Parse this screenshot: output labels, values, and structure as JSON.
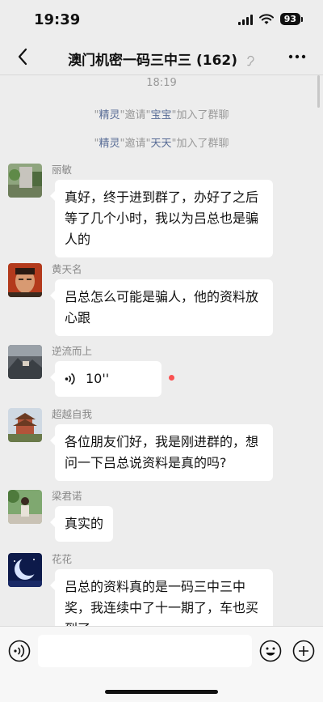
{
  "status_bar": {
    "time": "19:39",
    "battery": "93"
  },
  "header": {
    "title": "澳门机密一码三中三 (162)",
    "back_icon": "chevron-left-icon",
    "more_icon": "more-dots-icon",
    "mute_icon": "ear-mute-icon"
  },
  "chat": {
    "timestamp": "18:19",
    "system_messages": [
      {
        "pre": "\"",
        "inviter": "精灵",
        "mid": "\"邀请\"",
        "invitee": "宝宝",
        "post": "\"加入了群聊"
      },
      {
        "pre": "\"",
        "inviter": "精灵",
        "mid": "\"邀请\"",
        "invitee": "天天",
        "post": "\"加入了群聊"
      }
    ],
    "messages": [
      {
        "sender": "丽敏",
        "text": "真好，终于进到群了，办好了之后等了几个小时，我以为吕总也是骗人的"
      },
      {
        "sender": "黄天名",
        "text": "吕总怎么可能是骗人，他的资料放心跟"
      },
      {
        "sender": "逆流而上",
        "voice_duration": "10''",
        "unread": true
      },
      {
        "sender": "超越自我",
        "text": "各位朋友们好，我是刚进群的，想问一下吕总说资料是真的吗?"
      },
      {
        "sender": "梁君诺",
        "text": "真实的"
      },
      {
        "sender": "花花",
        "text": "吕总的资料真的是一码三中三中奖，我连续中了十一期了，车也买到了"
      }
    ]
  },
  "input_bar": {
    "voice_icon": "voice-input-icon",
    "emoji_icon": "emoji-icon",
    "plus_icon": "plus-circle-icon",
    "value": ""
  },
  "colors": {
    "background": "#ededed",
    "bubble": "#ffffff",
    "name_link": "#576b95",
    "unread": "#fa5151"
  }
}
